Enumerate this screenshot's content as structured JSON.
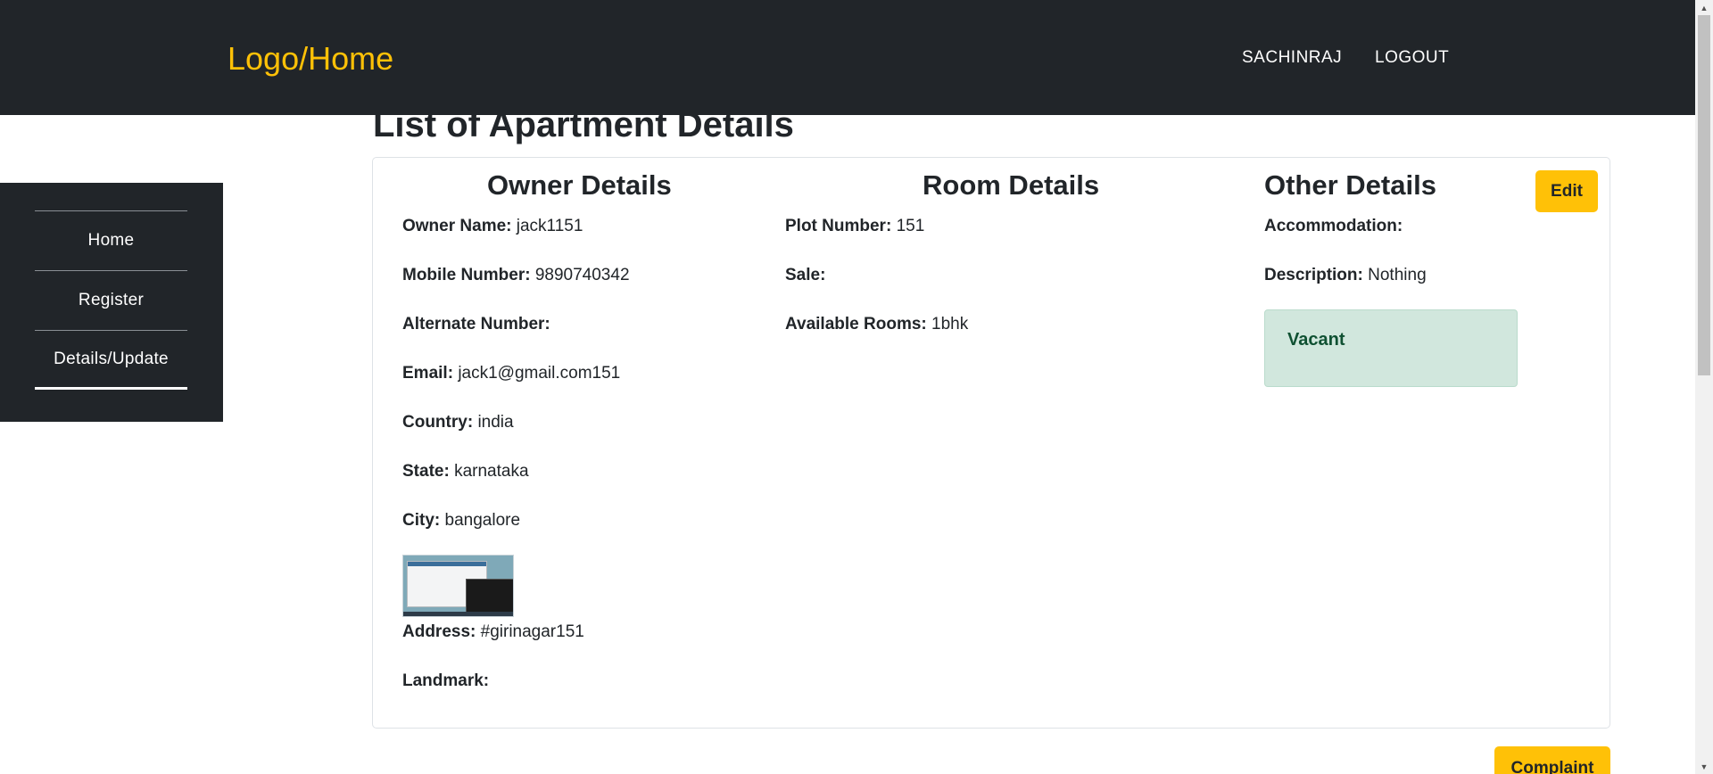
{
  "nav": {
    "logo": "Logo/Home",
    "user": "SACHINRAJ",
    "logout": "LOGOUT"
  },
  "sidebar": {
    "items": [
      {
        "label": "Home"
      },
      {
        "label": "Register"
      },
      {
        "label": "Details/Update"
      }
    ]
  },
  "page": {
    "title": "List of Apartment Details"
  },
  "owner": {
    "heading": "Owner Details",
    "fields": [
      {
        "label": "Owner Name:",
        "value": "jack1151"
      },
      {
        "label": "Mobile Number:",
        "value": "9890740342"
      },
      {
        "label": "Alternate Number:",
        "value": ""
      },
      {
        "label": "Email:",
        "value": "jack1@gmail.com151"
      },
      {
        "label": "Country:",
        "value": "india"
      },
      {
        "label": "State:",
        "value": "karnataka"
      },
      {
        "label": "City:",
        "value": "bangalore"
      },
      {
        "label": "Address:",
        "value": "#girinagar151"
      },
      {
        "label": "Landmark:",
        "value": ""
      }
    ]
  },
  "room": {
    "heading": "Room Details",
    "fields": [
      {
        "label": "Plot Number:",
        "value": "151"
      },
      {
        "label": "Sale:",
        "value": ""
      },
      {
        "label": "Available Rooms:",
        "value": "1bhk"
      }
    ]
  },
  "other": {
    "heading": "Other Details",
    "fields": [
      {
        "label": "Accommodation:",
        "value": ""
      },
      {
        "label": "Description:",
        "value": "Nothing"
      }
    ],
    "status": "Vacant"
  },
  "buttons": {
    "edit": "Edit",
    "complaint": "Complaint"
  },
  "colors": {
    "navbar_bg": "#212529",
    "accent": "#ffc107",
    "status_bg": "#d1e7dd",
    "status_text": "#0f5132"
  }
}
